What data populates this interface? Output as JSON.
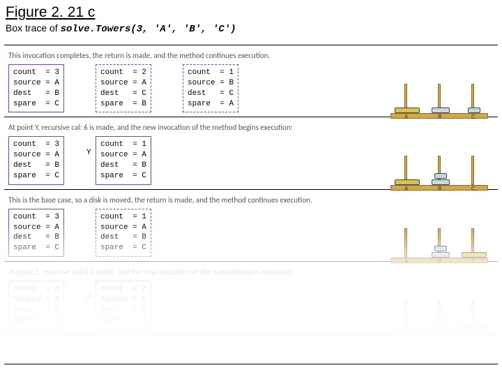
{
  "figure_label": "Figure 2. 21 c",
  "subtitle_prefix": "Box trace of ",
  "call_signature": "solve.Towers(3, 'A', 'B', 'C')",
  "sections": [
    {
      "caption": "This invocation completes, the return is made, and the method continues execution.",
      "boxes": [
        {
          "style": "solid",
          "lines": [
            "count  = 3",
            "source = A",
            "dest   = B",
            "spare  = C"
          ]
        },
        {
          "style": "dashed",
          "lines": [
            "count  = 2",
            "source = A",
            "dest   = C",
            "spare  = B"
          ]
        },
        {
          "style": "dashed",
          "lines": [
            "count  = 1",
            "source = B",
            "dest   = C",
            "spare  = A"
          ]
        }
      ],
      "tower": {
        "A": [
          "large"
        ],
        "B": [
          "med"
        ],
        "C": [
          "small"
        ]
      }
    },
    {
      "caption": "At point Y, recursive cal: 6 is made, and the new invocation of the method begins execution:",
      "arrow_label": "Y",
      "boxes": [
        {
          "style": "solid",
          "lines": [
            "count  = 3",
            "source = A",
            "dest   = B",
            "spare  = C"
          ]
        },
        {
          "style": "solid",
          "lines": [
            "count  = 1",
            "source = A",
            "dest   = B",
            "spare  = C"
          ]
        }
      ],
      "tower": {
        "A": [
          "large"
        ],
        "B": [
          "med",
          "small"
        ],
        "C": []
      }
    },
    {
      "caption": "This is the base case, so a disk is moved, the return is made, and the method continues execution.",
      "boxes": [
        {
          "style": "solid",
          "lines": [
            "count  = 3",
            "source = A",
            "dest   = B",
            "spare  = C"
          ]
        },
        {
          "style": "dashed",
          "lines": [
            "count  = 1",
            "source = A",
            "dest   = B",
            "spare  = C"
          ]
        }
      ],
      "tower": {
        "A": [],
        "B": [
          "med",
          "small"
        ],
        "C": [
          "large"
        ]
      }
    },
    {
      "caption": "At point Z, recursive call 8 is made, and the new invocation of the method begins execution:",
      "arrow_label": "Z",
      "boxes": [
        {
          "style": "solid",
          "lines": [
            "count  = 3",
            "source = A",
            "dest   = B",
            "spare  = C"
          ]
        },
        {
          "style": "solid",
          "lines": [
            "count  = 2",
            "source = C",
            "dest   = B",
            "spare  = A"
          ]
        }
      ],
      "tower": {
        "A": [],
        "B": [
          "med",
          "small"
        ],
        "C": [
          "large"
        ]
      }
    }
  ]
}
